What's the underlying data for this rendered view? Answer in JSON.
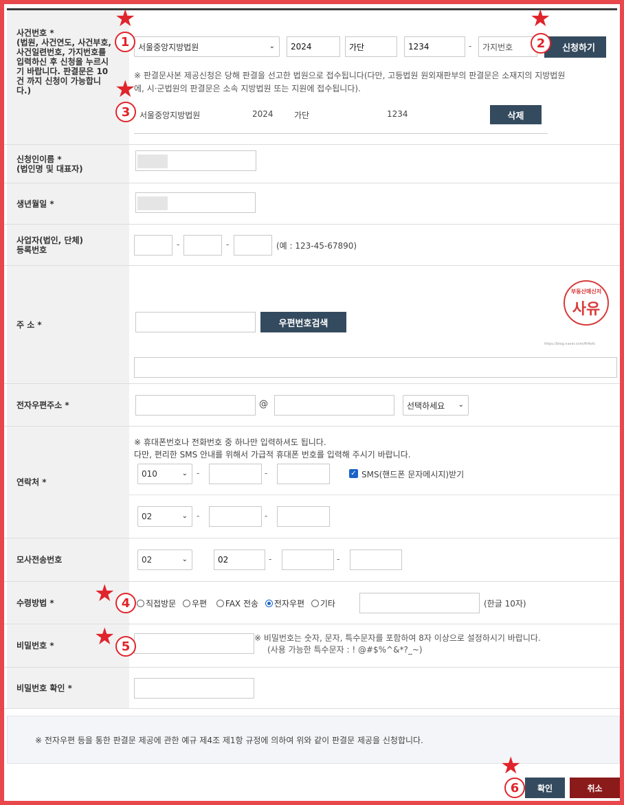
{
  "case": {
    "label": "사건번호 *",
    "desc": [
      "(법원, 사건연도, 사건부호,",
      "사건일련번호, 가지번호를",
      "입력하신 후 신청을 누르시",
      "기 바랍니다. 판결문은 10",
      "건 까지 신청이 가능합니",
      "다.)"
    ],
    "court_select": "서울중앙지방법원",
    "year": "2024",
    "code": "가단",
    "serial": "1234",
    "branch_placeholder": "가지번호",
    "apply_button": "신청하기",
    "notice": [
      "※ 판결문사본 제공신청은 당해 판결을 선고한 법원으로 접수됩니다(다만, 고등법원 원외재판부의 판결문은 소재지의 지방법원",
      "에, 시·군법원의 판결문은 소속 지방법원 또는 지원에 접수됩니다)."
    ],
    "entry": {
      "court": "서울중앙지방법원",
      "year": "2024",
      "code": "가단",
      "serial": "1234",
      "delete_button": "삭제"
    }
  },
  "applicant": {
    "label": [
      "신청인이름 *",
      "(법인명 및 대표자)"
    ]
  },
  "birth": {
    "label": "생년월일 *"
  },
  "business": {
    "label": [
      "사업자(법인, 단체)",
      "등록번호"
    ],
    "example": "(예 : 123-45-67890)"
  },
  "address": {
    "label": "주 소 *",
    "zip_button": "우편번호검색"
  },
  "email": {
    "label": "전자우편주소 *",
    "at": "@",
    "domain_select": "선택하세요"
  },
  "contact": {
    "label": "연락처 *",
    "notice": [
      "※ 휴대폰번호나 전화번호 중 하나만 입력하셔도 됩니다.",
      "다만, 편리한 SMS 안내를 위해서 가급적 휴대폰 번호를 입력해 주시기 바랍니다."
    ],
    "mobile_prefix": "010",
    "sms_label": "SMS(핸드폰 문자메시지)받기",
    "phone_prefix": "02"
  },
  "fax": {
    "label": "모사전송번호",
    "prefix_select": "02",
    "area": "02"
  },
  "receive": {
    "label": "수령방법 *",
    "options": [
      "직접방문",
      "우편",
      "FAX 전송",
      "전자우편",
      "기타"
    ],
    "selected": "전자우편",
    "limit": "(한글 10자)"
  },
  "password": {
    "label": "비밀번호 *",
    "notice": [
      "※ 비밀번호는 숫자, 문자, 특수문자를 포함하여 8자 이상으로 설정하시기 바랍니다.",
      "(사용 가능한 특수문자 : ! @#$%^&*?_~)"
    ]
  },
  "password_confirm": {
    "label": "비밀번호 확인 *"
  },
  "agreement": "※ 전자우편 등을 통한 판결문 제공에 관한 예규 제4조 제1항 규정에 의하여 위와 같이 판결문 제공을 신청합니다.",
  "buttons": {
    "confirm": "확인",
    "cancel": "취소"
  },
  "markers": [
    "1",
    "2",
    "3",
    "4",
    "5",
    "6"
  ],
  "logo": {
    "top": "부동산매신저",
    "main": "사유",
    "url": "https://blog.naver.com/fit4ofs"
  },
  "colors": {
    "accent": "#e0242b",
    "navy": "#344a5e",
    "cancel": "#8b1a1a",
    "border": "#e8474c"
  }
}
